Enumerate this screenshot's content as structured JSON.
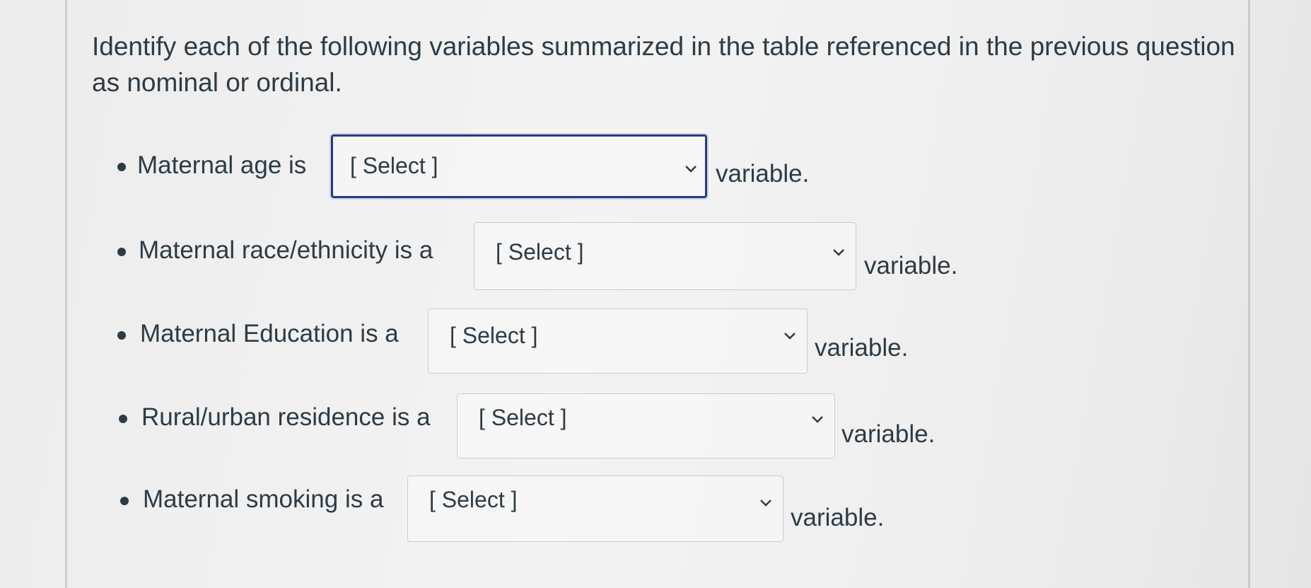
{
  "question": {
    "prompt": "Identify each of the following variables summarized in the table referenced in the previous question as nominal or ordinal."
  },
  "items": [
    {
      "label": "Maternal age is",
      "select_value": "[ Select ]",
      "suffix": "variable.",
      "focused": true
    },
    {
      "label": "Maternal race/ethnicity is a",
      "select_value": "[ Select ]",
      "suffix": "variable.",
      "focused": false
    },
    {
      "label": "Maternal Education is a",
      "select_value": "[ Select ]",
      "suffix": "variable.",
      "focused": false
    },
    {
      "label": "Rural/urban residence is a",
      "select_value": "[ Select ]",
      "suffix": "variable.",
      "focused": false
    },
    {
      "label": "Maternal smoking is a",
      "select_value": "[ Select ]",
      "suffix": "variable.",
      "focused": false
    }
  ],
  "icons": {
    "bullet": "bullet-dot",
    "dropdown": "chevron-down-icon"
  },
  "colors": {
    "text": "#2d3b45",
    "focus_border": "#283a8c",
    "select_border": "#c7cdd1"
  }
}
